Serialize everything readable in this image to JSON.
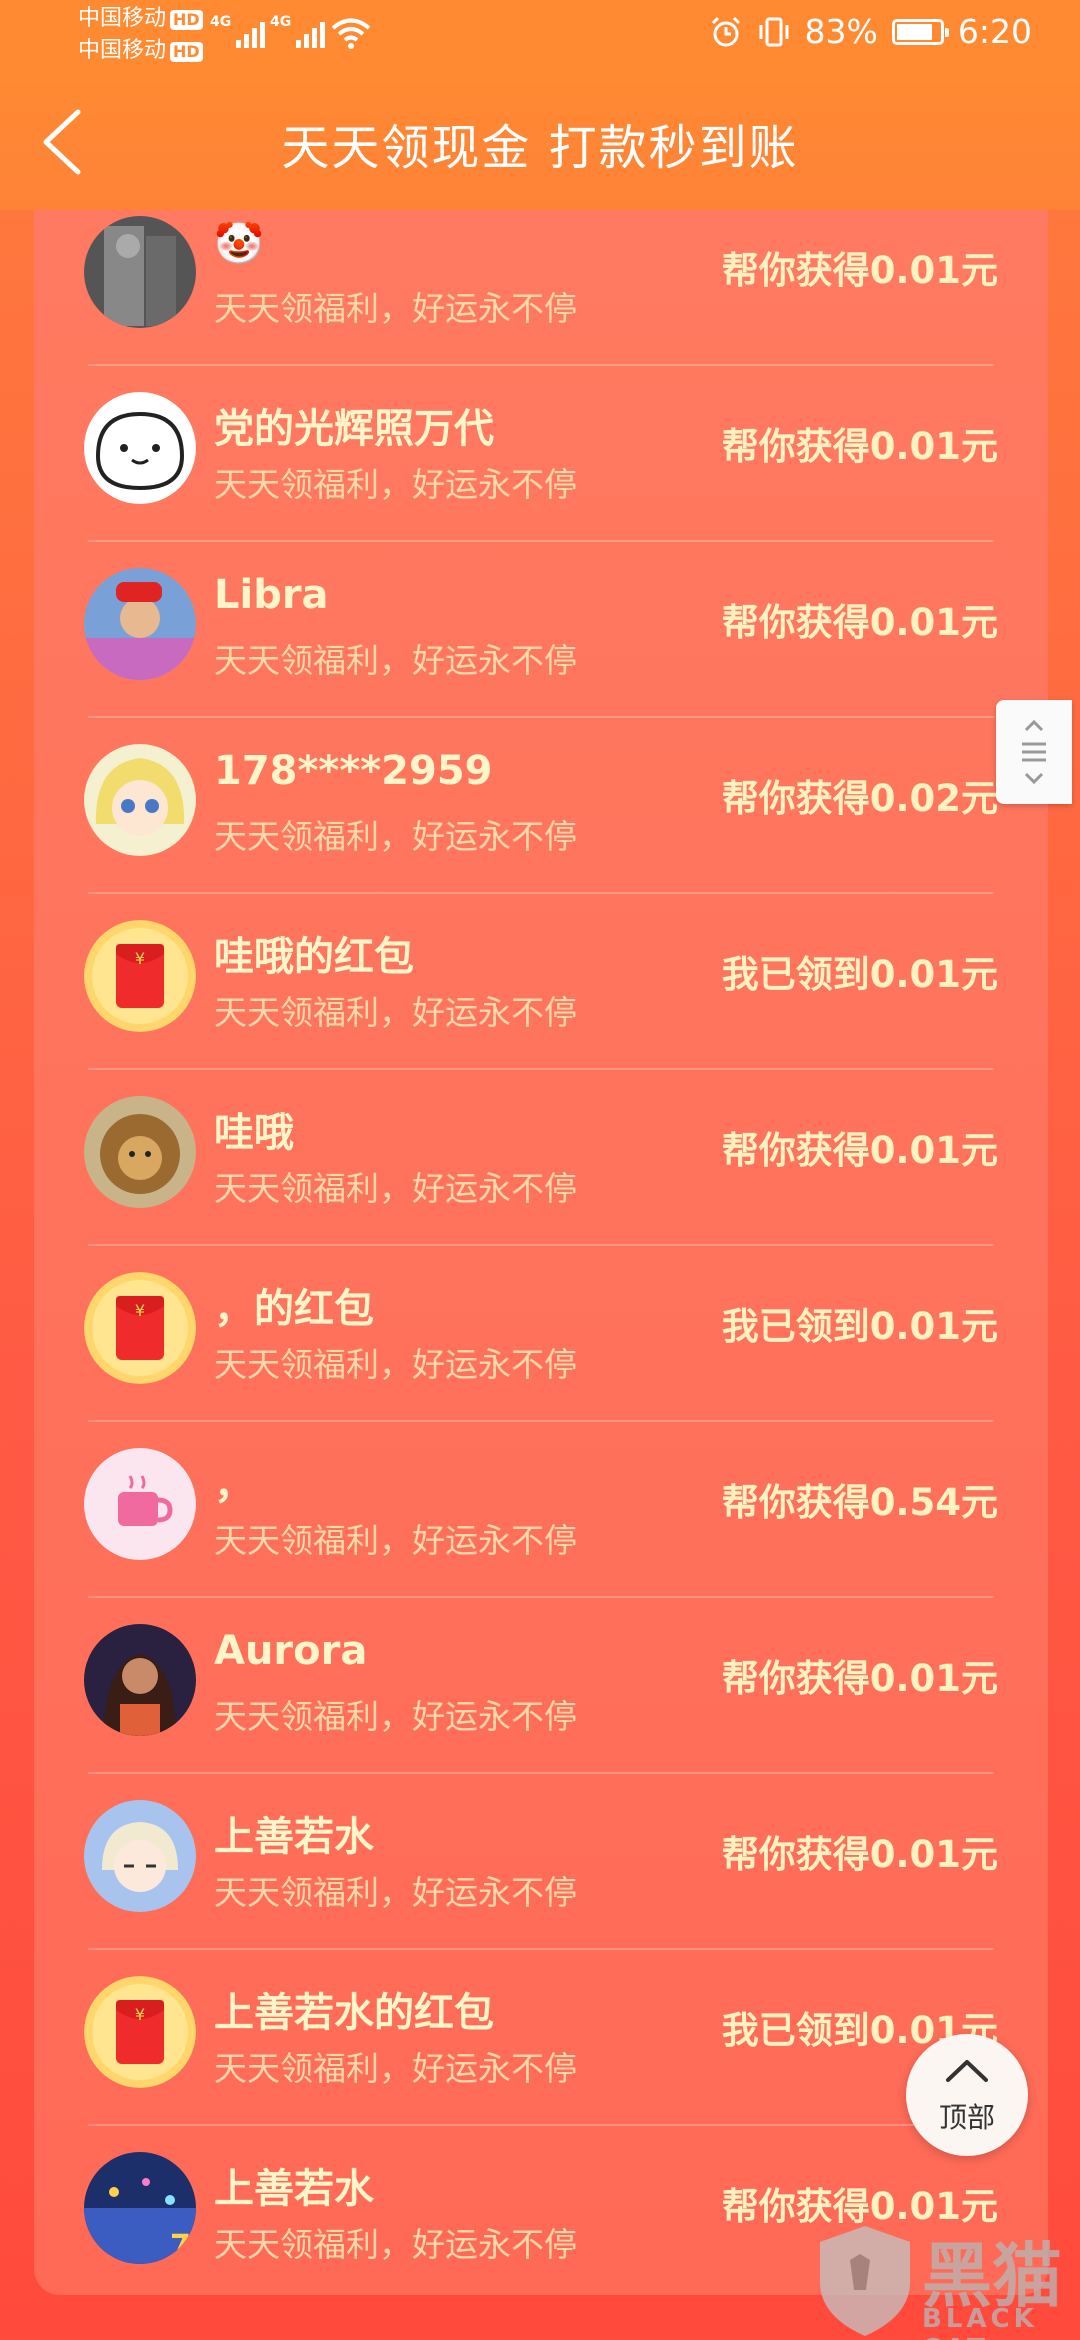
{
  "status_bar": {
    "carrier1": "中国移动",
    "carrier2": "中国移动",
    "hd_badge": "HD",
    "network_tag": "4G",
    "battery_percent": "83%",
    "battery_level": 0.83,
    "time": "6:20",
    "icons": [
      "alarm-icon",
      "vibrate-icon",
      "wifi-icon",
      "signal-icon",
      "battery-icon"
    ]
  },
  "header": {
    "title": "天天领现金 打款秒到账",
    "back_icon": "chevron-left-icon"
  },
  "list": {
    "items": [
      {
        "name": "🤡",
        "subtitle": "天天领福利，好运永不停",
        "amount": "帮你获得0.01元",
        "avatar": "photo-avatar-gray"
      },
      {
        "name": "党的光辉照万代",
        "subtitle": "天天领福利，好运永不停",
        "amount": "帮你获得0.01元",
        "avatar": "cartoon-cat-avatar"
      },
      {
        "name": "Libra",
        "subtitle": "天天领福利，好运永不停",
        "amount": "帮你获得0.01元",
        "avatar": "photo-avatar-red-hat"
      },
      {
        "name": "178****2959",
        "subtitle": "天天领福利，好运永不停",
        "amount": "帮你获得0.02元",
        "avatar": "anime-girl-avatar"
      },
      {
        "name": "哇哦的红包",
        "subtitle": "天天领福利，好运永不停",
        "amount": "我已领到0.01元",
        "avatar": "red-envelope-icon"
      },
      {
        "name": "哇哦",
        "subtitle": "天天领福利，好运永不停",
        "amount": "帮你获得0.01元",
        "avatar": "lion-avatar"
      },
      {
        "name": "，的红包",
        "subtitle": "天天领福利，好运永不停",
        "amount": "我已领到0.01元",
        "avatar": "red-envelope-icon"
      },
      {
        "name": "，",
        "subtitle": "天天领福利，好运永不停",
        "amount": "帮你获得0.54元",
        "avatar": "pink-cup-avatar"
      },
      {
        "name": "Aurora",
        "subtitle": "天天领福利，好运永不停",
        "amount": "帮你获得0.01元",
        "avatar": "photo-avatar-woman"
      },
      {
        "name": "上善若水",
        "subtitle": "天天领福利，好运永不停",
        "amount": "帮你获得0.01元",
        "avatar": "anime-boy-avatar"
      },
      {
        "name": "上善若水的红包",
        "subtitle": "天天领福利，好运永不停",
        "amount": "我已领到0.01元",
        "avatar": "red-envelope-icon"
      },
      {
        "name": "上善若水",
        "subtitle": "天天领福利，好运永不停",
        "amount": "帮你获得0.01元",
        "avatar": "city-lights-avatar"
      }
    ]
  },
  "top_button": {
    "label": "顶部",
    "icon": "chevron-up-icon"
  },
  "watermark": {
    "text": "黑猫",
    "sub": "BLACK CAT"
  },
  "colors": {
    "header_bg": "#ff8a32",
    "card_bg": "#ff6a56",
    "text_highlight": "#fff5c8"
  }
}
